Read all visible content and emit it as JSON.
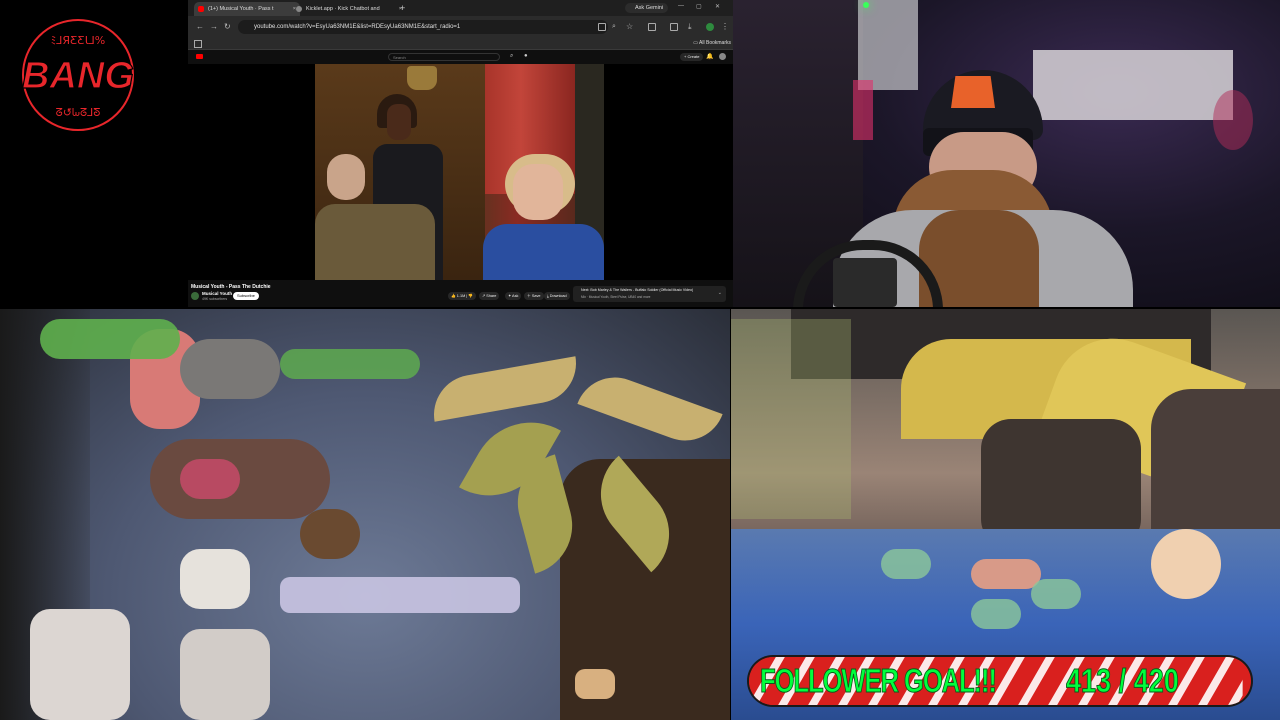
{
  "logo": {
    "name": "BANG",
    "top_text": "ﾐ⅃ЯƸƸƖ⅃%",
    "bottom_text": "ᘔ↺ᘈᘔ⅃ᘕ",
    "color": "#e8262b"
  },
  "browser": {
    "tabs": [
      {
        "label": "(1+) Musical Youth · Pass t",
        "active": true
      },
      {
        "label": "Kicklet.app · Kick Chatbot and",
        "active": false
      }
    ],
    "ask_gemini": "Ask Gemini",
    "url": "youtube.com/watch?v=EsyUa63NM1E&list=RDEsyUa63NM1E&start_radio=1",
    "bookmarks_label": "All Bookmarks",
    "youtube": {
      "search_placeholder": "Search",
      "create_label": "+ Create",
      "video_title": "Musical Youth - Pass The Dutchie",
      "channel_name": "Musical Youth",
      "channel_subs": "49K subscribers",
      "subscribe_label": "Subscribe",
      "like_count": "1.1M",
      "share_label": "Share",
      "ask_label": "Ask",
      "save_label": "Save",
      "download_label": "Download",
      "next_up_title": "Next: Bob Marley & The Wailers - Buffalo Soldier (Official Music Video)",
      "next_up_sub": "Mix · Musical Youth, Steel Pulse, UB40 and more"
    }
  },
  "follower_goal": {
    "label": "FOLLOWER GOAL!!!",
    "current": 413,
    "target": 420,
    "count_text": "413 / 420",
    "text_color": "#00ff3c",
    "bar_color": "#d9201e",
    "stripe_color": "#ffffff"
  },
  "cameras": {
    "webcam_icon": "webcam-feed",
    "tank1_icon": "tank-cam-1",
    "tank2_icon": "tank-cam-2"
  }
}
